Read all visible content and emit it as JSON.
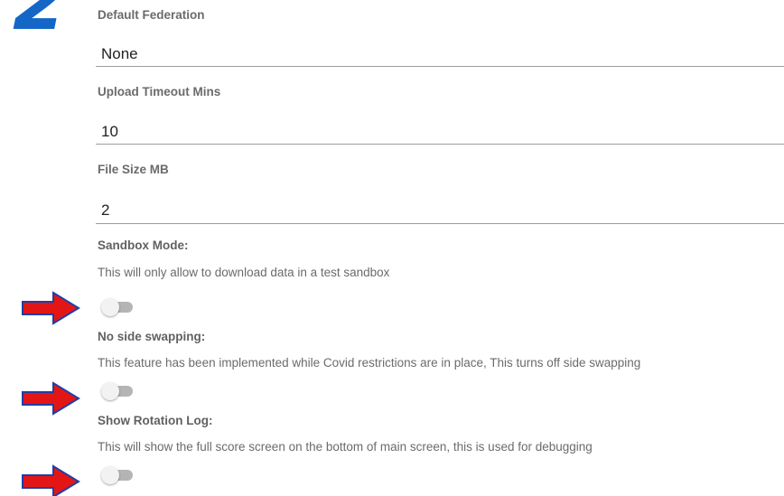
{
  "step": {
    "number": "2",
    "color": "#1467c7"
  },
  "fields": [
    {
      "label": "Default Federation",
      "value": "None"
    },
    {
      "label": "Upload Timeout Mins",
      "value": "10"
    },
    {
      "label": "File Size MB",
      "value": "2"
    }
  ],
  "toggles": [
    {
      "title": "Sandbox Mode:",
      "description": "This will only allow to download data in a test sandbox",
      "checked": false
    },
    {
      "title": "No side swapping:",
      "description": "This feature has been implemented while Covid restrictions are in place, This turns off side swapping",
      "checked": false
    },
    {
      "title": "Show Rotation Log:",
      "description": "This will show the full score screen on the bottom of main screen, this is used for debugging",
      "checked": false
    }
  ],
  "annotations": {
    "arrow_icon": "red-right-arrow-icon",
    "arrow_fill": "#e41515",
    "arrow_stroke": "#1f3fa5"
  }
}
